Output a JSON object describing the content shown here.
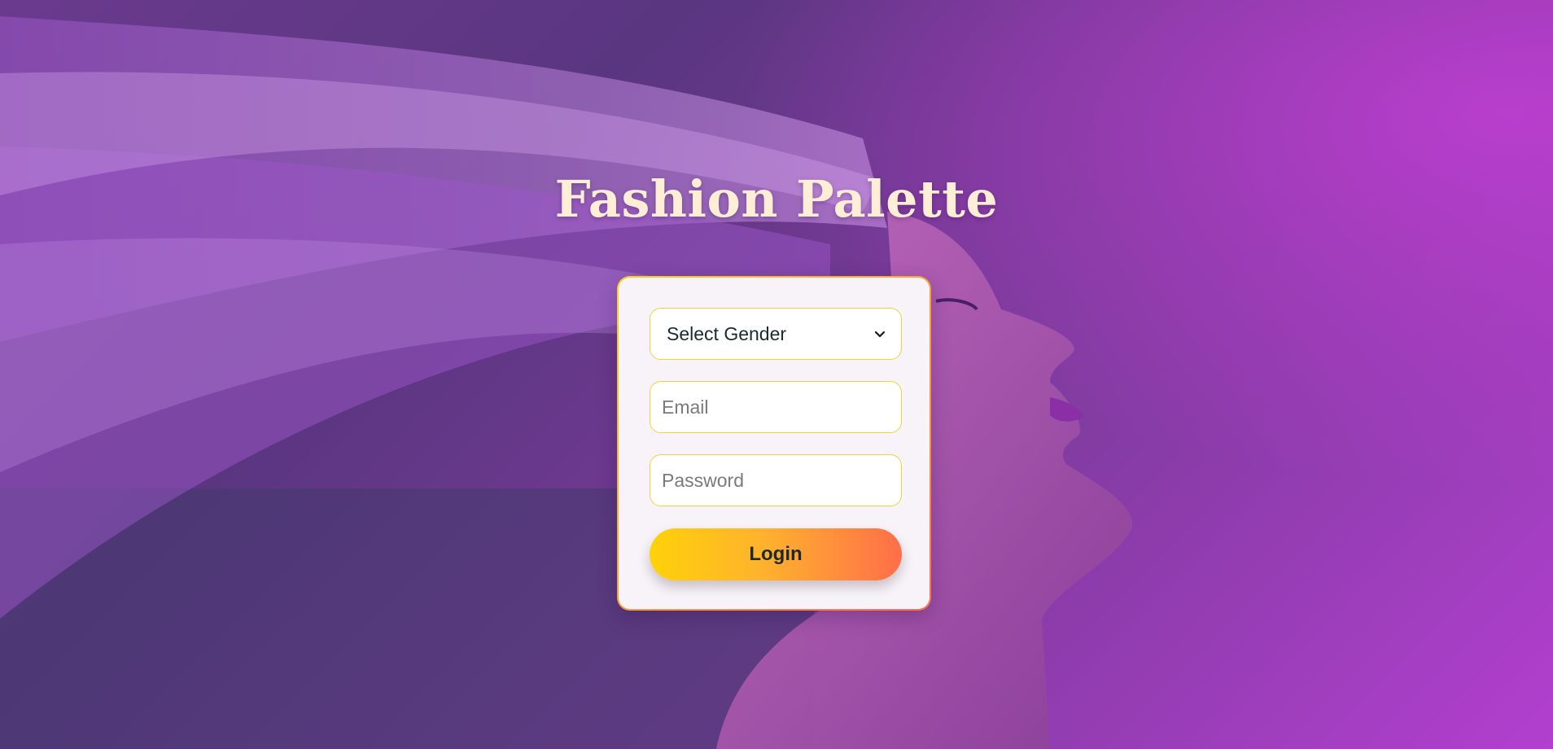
{
  "page": {
    "title": "Fashion Palette"
  },
  "background": {
    "description_icon": "woman-profile-flowing-hair-image",
    "accent_color": "#b23fcf"
  },
  "login_form": {
    "gender_select": {
      "selected": "Select Gender"
    },
    "email": {
      "placeholder": "Email",
      "value": ""
    },
    "password": {
      "placeholder": "Password",
      "value": ""
    },
    "login_label": "Login",
    "button_gradient": [
      "#ffd10a",
      "#ff6e4a"
    ],
    "border_color": "#f1d23a"
  }
}
